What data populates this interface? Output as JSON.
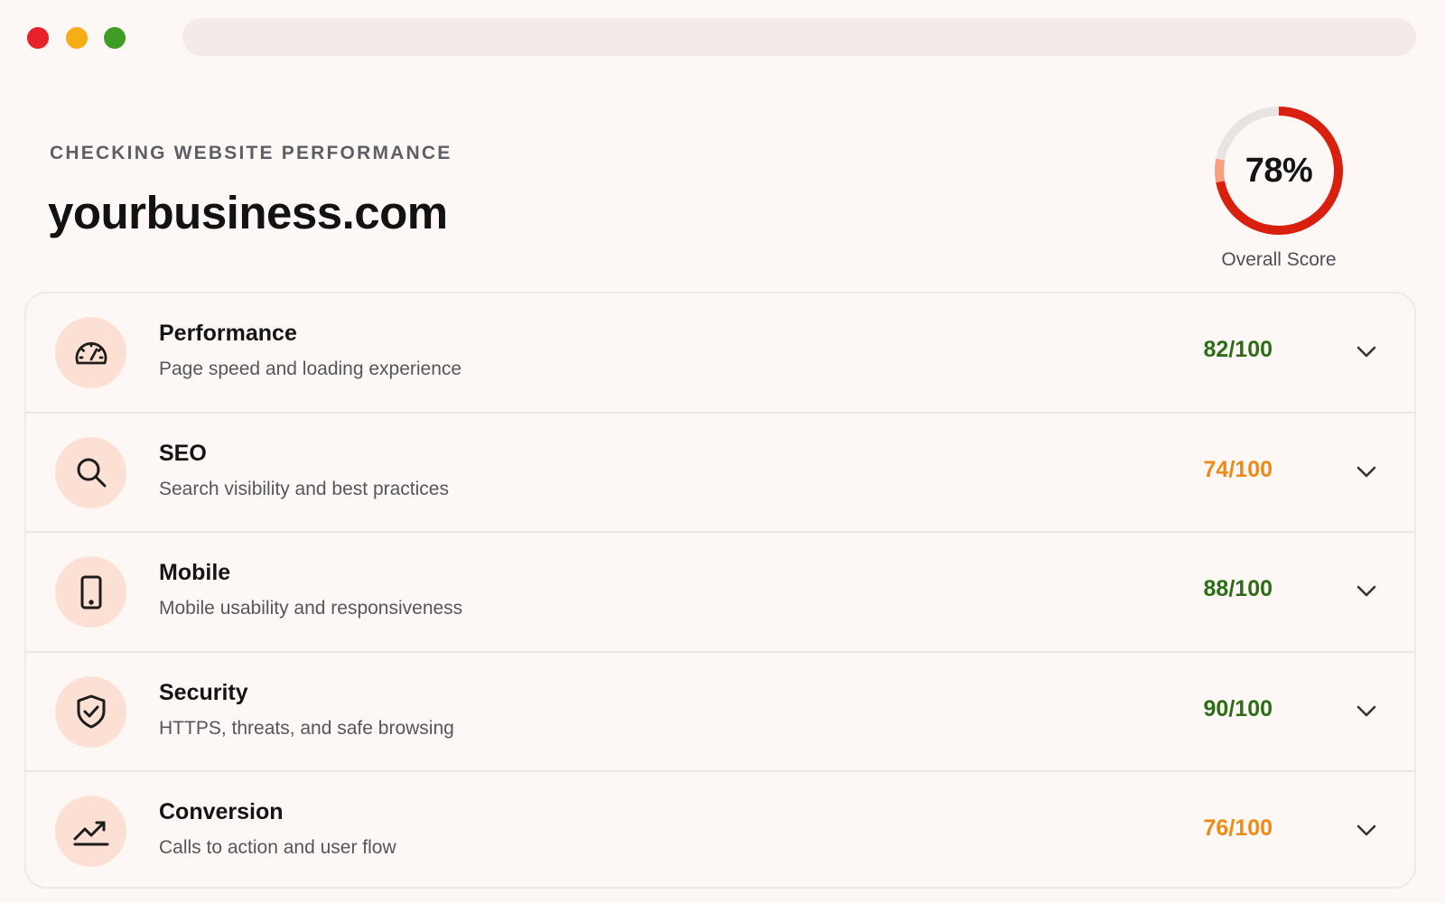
{
  "window": {
    "controls": [
      "close",
      "minimize",
      "maximize"
    ],
    "address_bar": ""
  },
  "header": {
    "eyebrow": "CHECKING WEBSITE PERFORMANCE",
    "domain": "yourbusiness.com"
  },
  "overall": {
    "percent": 78,
    "percent_label": "78%",
    "label": "Overall Score",
    "ring_color": "#d9200f",
    "ring_tail_color": "#f6a07f",
    "track_color": "#e8e4e2"
  },
  "categories": [
    {
      "title": "Performance",
      "description": "Page speed and loading experience",
      "score": "82/100",
      "icon": "speedometer-icon",
      "status_color": "#2e6d17"
    },
    {
      "title": "SEO",
      "description": "Search visibility and best practices",
      "score": "74/100",
      "icon": "search-icon",
      "status_color": "#f08a13"
    },
    {
      "title": "Mobile",
      "description": "Mobile usability and responsiveness",
      "score": "88/100",
      "icon": "mobile-phone-icon",
      "status_color": "#2e6d17"
    },
    {
      "title": "Security",
      "description": "HTTPS, threats, and safe browsing",
      "score": "90/100",
      "icon": "shield-check-icon",
      "status_color": "#2e6d17"
    },
    {
      "title": "Conversion",
      "description": "Calls to action and user flow",
      "score": "76/100",
      "icon": "trend-up-icon",
      "status_color": "#f08a13"
    }
  ]
}
